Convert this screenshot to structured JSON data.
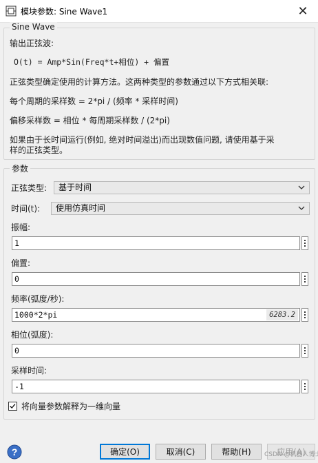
{
  "window": {
    "title": "模块参数: Sine Wave1",
    "close_symbol": "✕"
  },
  "block_group": {
    "label": "Sine Wave",
    "lines": [
      "输出正弦波:",
      "O(t) = Amp*Sin(Freq*t+相位) + 偏置",
      "正弦类型确定使用的计算方法。这两种类型的参数通过以下方式相关联:",
      "每个周期的采样数 = 2*pi / (频率 * 采样时间)",
      "偏移采样数 = 相位 * 每周期采样数 / (2*pi)",
      "如果由于长时间运行(例如, 绝对时间溢出)而出现数值问题, 请使用基于采",
      "样的正弦类型。"
    ]
  },
  "params": {
    "label": "参数",
    "sine_type": {
      "label": "正弦类型:",
      "value": "基于时间"
    },
    "time": {
      "label": "时间(t):",
      "value": "使用仿真时间"
    },
    "amplitude": {
      "label": "振幅:",
      "value": "1"
    },
    "bias": {
      "label": "偏置:",
      "value": "0"
    },
    "frequency": {
      "label": "频率(弧度/秒):",
      "value": "1000*2*pi",
      "evaluated": "6283.2"
    },
    "phase": {
      "label": "相位(弧度):",
      "value": "0"
    },
    "sample_time": {
      "label": "采样时间:",
      "value": "-1"
    },
    "interpret_vector": {
      "label": "将向量参数解释为一维向量",
      "checked": true
    }
  },
  "buttons": {
    "ok": "确定(O)",
    "cancel": "取消(C)",
    "help": "帮助(H)",
    "apply": "应用(A)"
  },
  "watermark": "CSDN @机器人博士",
  "colors": {
    "accent": "#0078d7",
    "help_icon": "#3a6fc6"
  }
}
